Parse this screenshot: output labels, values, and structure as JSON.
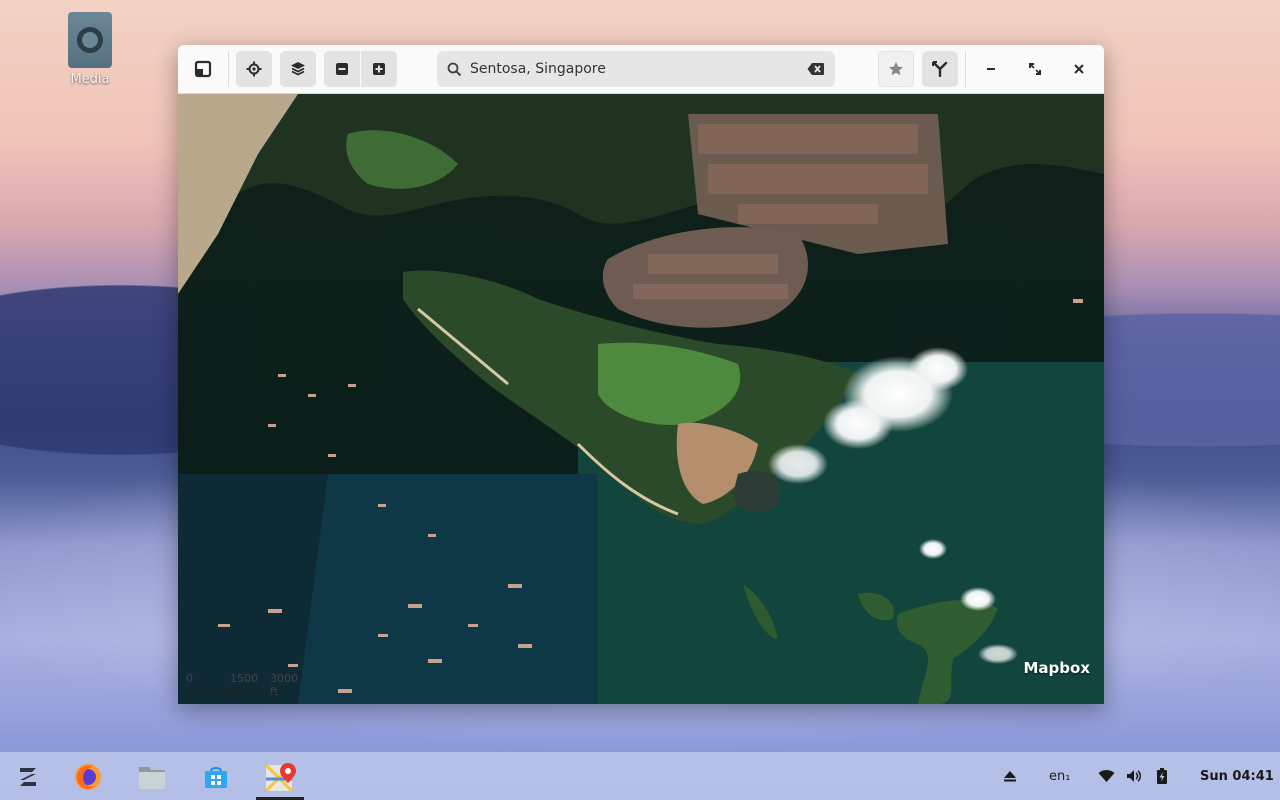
{
  "desktop": {
    "icons": [
      {
        "label": "Media",
        "icon": "media-disc-icon"
      }
    ]
  },
  "window": {
    "app": "maps",
    "toolbar": {
      "icons": [
        "bookmark-panel-icon",
        "locate-icon",
        "layers-icon",
        "zoom-out-icon",
        "zoom-in-icon"
      ]
    },
    "search": {
      "value": "Sentosa, Singapore",
      "icon": "search-icon",
      "clear_icon": "backspace-clear-icon"
    },
    "right_icons": [
      "star-icon",
      "route-icon"
    ],
    "controls": [
      "minimize-icon",
      "maximize-icon",
      "close-icon"
    ],
    "map": {
      "layer": "satellite",
      "place": "Sentosa, Singapore",
      "scale": {
        "labels": [
          "0",
          "1500",
          "3000 ft"
        ]
      },
      "provider": "Mapbox"
    }
  },
  "taskbar": {
    "apps": [
      {
        "name": "zorin-menu",
        "icon": "zorin-logo-icon",
        "active": false
      },
      {
        "name": "firefox",
        "icon": "firefox-icon",
        "active": false
      },
      {
        "name": "files",
        "icon": "files-folder-icon",
        "active": false
      },
      {
        "name": "software",
        "icon": "software-store-icon",
        "active": false
      },
      {
        "name": "maps",
        "icon": "maps-icon",
        "active": true
      }
    ],
    "tray": {
      "eject_icon": "eject-icon",
      "language": "en₁",
      "wifi_icon": "wifi-icon",
      "volume_icon": "volume-icon",
      "battery_icon": "battery-icon",
      "clock": "Sun 04:41"
    }
  },
  "colors": {
    "accent": "#e3e3e3",
    "taskbar": "#b8c3e8"
  }
}
